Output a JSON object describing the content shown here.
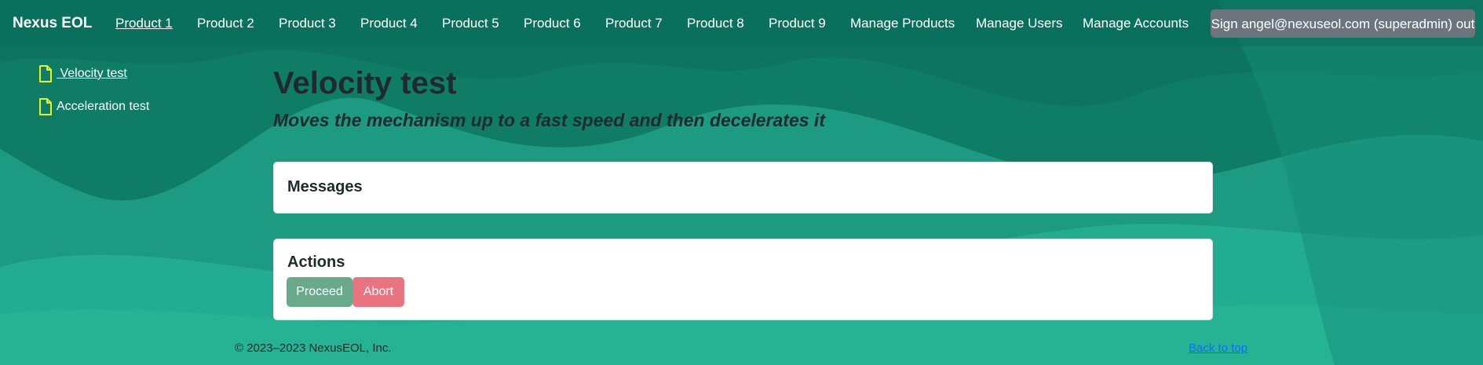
{
  "navbar": {
    "brand": "Nexus EOL",
    "items": [
      {
        "label": "Product 1",
        "active": true
      },
      {
        "label": "Product 2"
      },
      {
        "label": "Product 3"
      },
      {
        "label": "Product 4"
      },
      {
        "label": "Product 5"
      },
      {
        "label": "Product 6"
      },
      {
        "label": "Product 7"
      },
      {
        "label": "Product 8"
      },
      {
        "label": "Product 9"
      },
      {
        "label": "Manage Products"
      },
      {
        "label": "Manage Users"
      },
      {
        "label": "Manage Accounts"
      }
    ],
    "sign_out": "Sign angel@nexuseol.com (superadmin) out"
  },
  "sidebar": {
    "items": [
      {
        "label": " Velocity test",
        "icon": "file-icon",
        "active": true
      },
      {
        "label": "Acceleration test",
        "icon": "file-icon"
      }
    ]
  },
  "main": {
    "title": "Velocity test",
    "subtitle": "Moves the mechanism up to a fast speed and then decelerates it",
    "messages_card": {
      "title": "Messages"
    },
    "actions_card": {
      "title": "Actions",
      "proceed": "Proceed",
      "abort": "Abort"
    }
  },
  "footer": {
    "copyright": "© 2023–2023 NexusEOL, Inc.",
    "back_to_top": "Back to top"
  },
  "colors": {
    "accent": "#1f9e84",
    "icon": "#e8f515",
    "proceed": "#6aaa8c",
    "abort": "#e8747f",
    "sign_button": "#6c757d"
  }
}
